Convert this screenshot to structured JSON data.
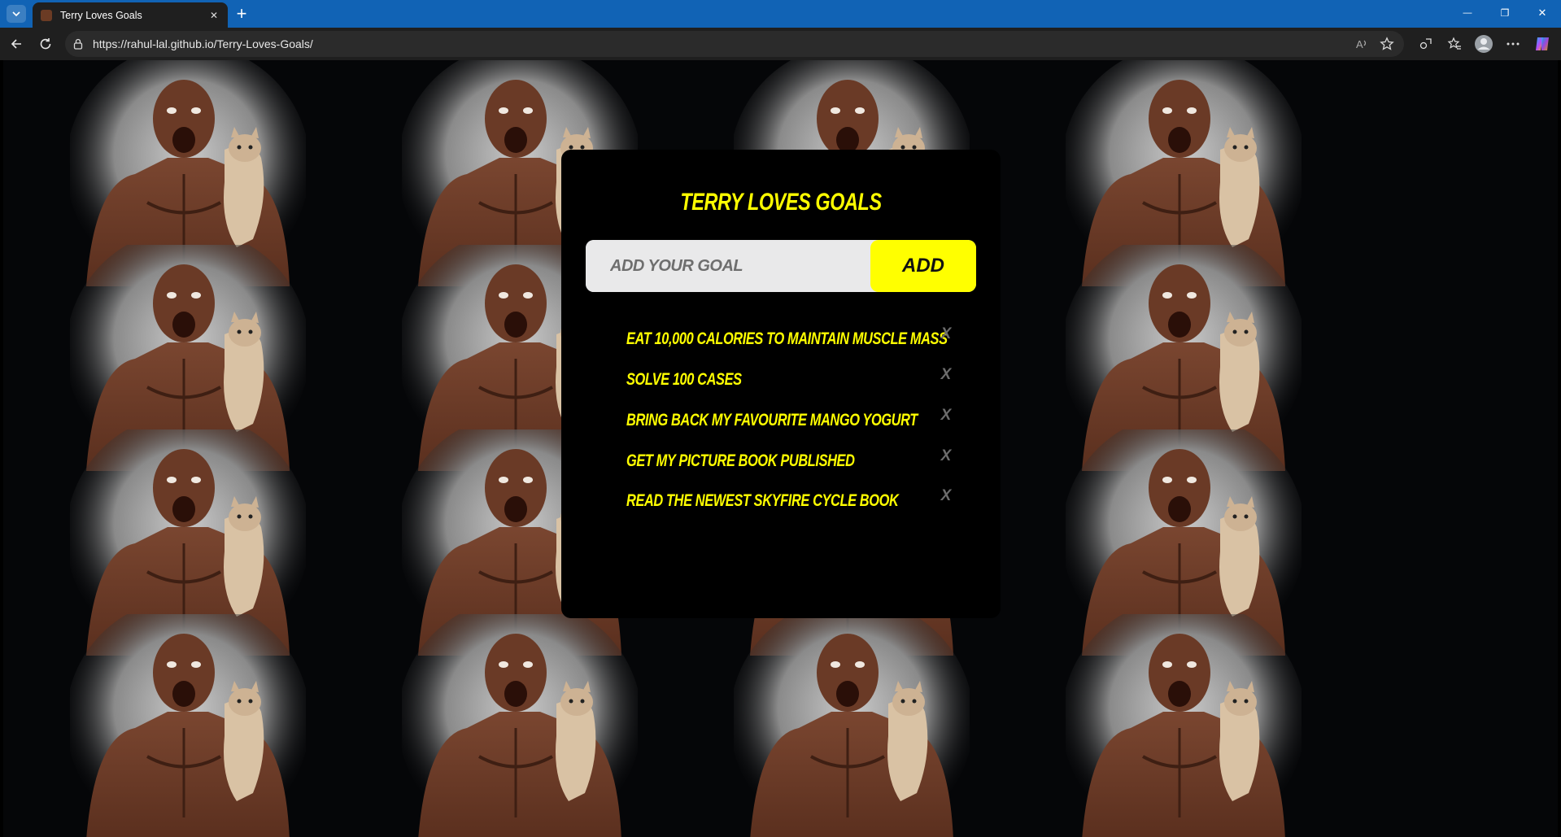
{
  "browser": {
    "tab_title": "Terry Loves Goals",
    "url": "https://rahul-lal.github.io/Terry-Loves-Goals/",
    "tab_close_glyph": "✕",
    "new_tab_glyph": "+",
    "controls": {
      "minimize": "—",
      "restore": "❐",
      "close": "✕"
    },
    "toolbar_icons": [
      "back-arrow-icon",
      "refresh-icon",
      "lock-icon",
      "read-aloud-icon",
      "favorite-star-icon",
      "extensions-icon",
      "favorites-icon",
      "profile-icon",
      "more-icon",
      "copilot-icon"
    ]
  },
  "app": {
    "title": "TERRY LOVES GOALS",
    "input_placeholder": "ADD YOUR GOAL",
    "add_label": "ADD",
    "remove_label": "X",
    "goals": [
      "EAT 10,000 CALORIES TO MAINTAIN MUSCLE MASS",
      "SOLVE 100 CASES",
      "BRING BACK MY FAVOURITE MANGO YOGURT",
      "GET MY PICTURE BOOK PUBLISHED",
      "READ THE NEWEST SKYFIRE CYCLE BOOK"
    ],
    "colors": {
      "accent": "#ffff00",
      "card": "#000000",
      "input_bg": "#e9e9ea",
      "remove": "#6c6c6c"
    }
  },
  "background_image": "terry-crews-holding-grumpy-cat-tile"
}
